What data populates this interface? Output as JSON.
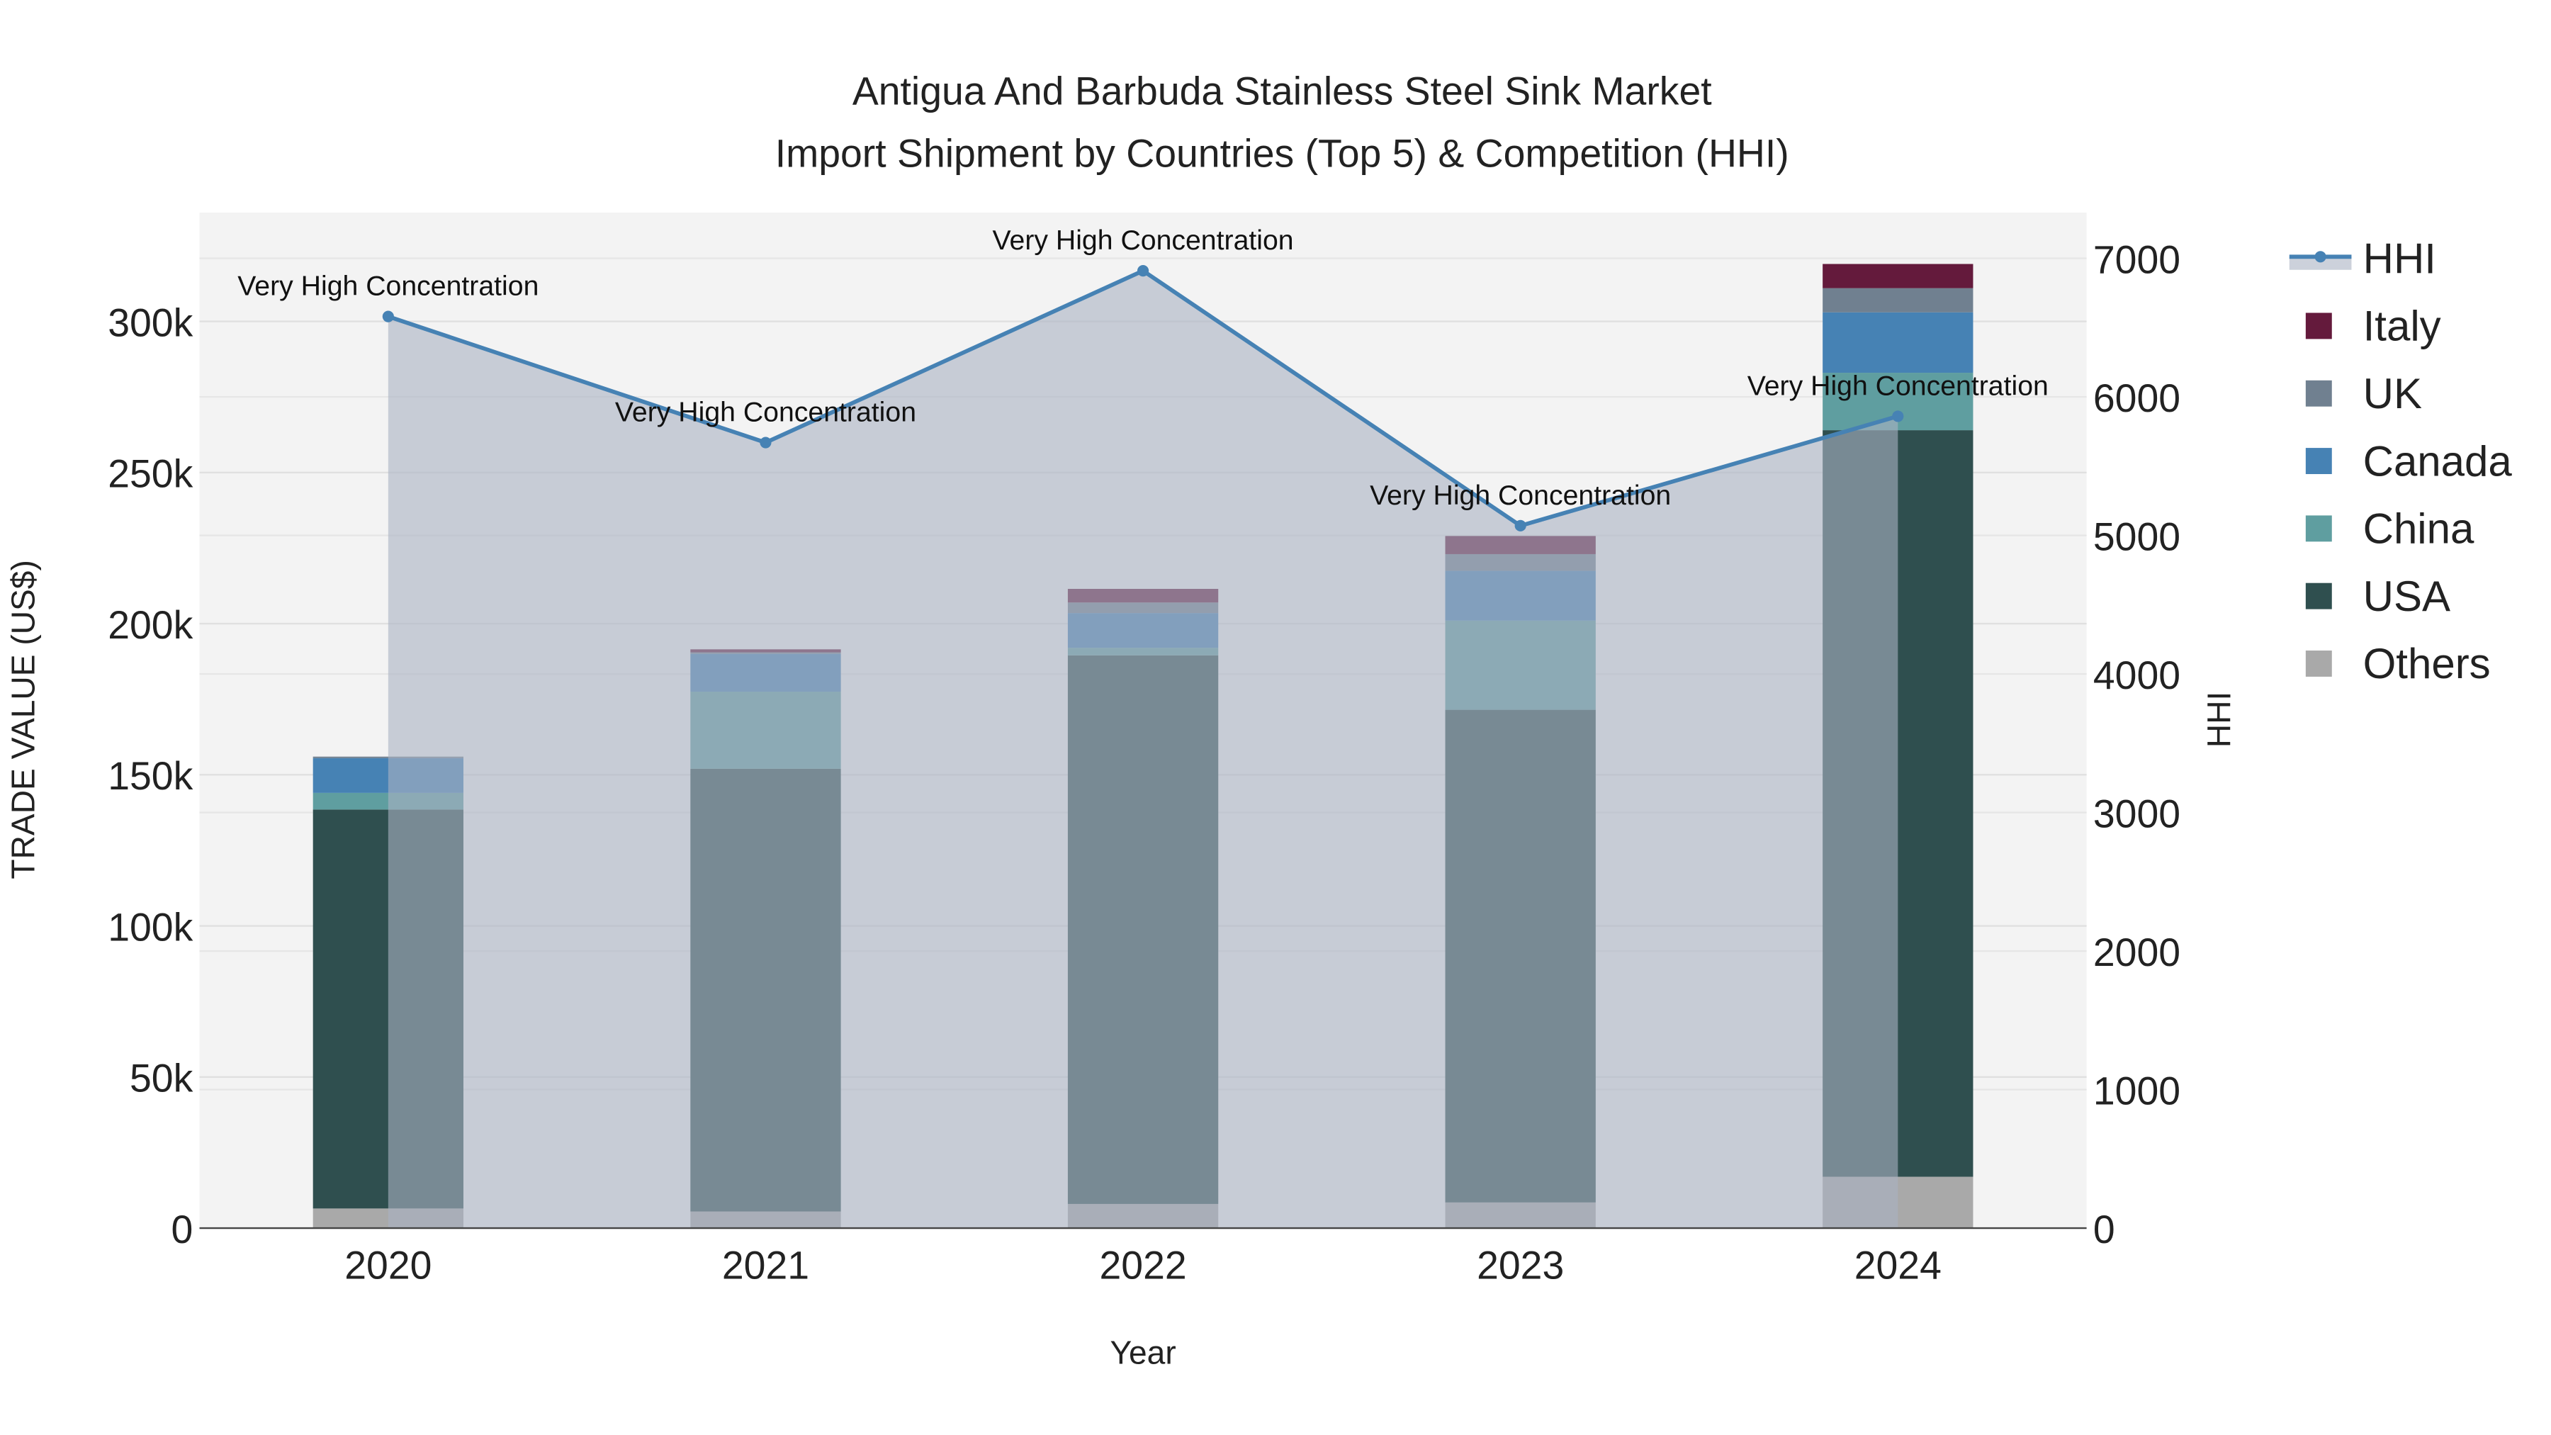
{
  "chart_data": {
    "type": "bar",
    "title_line1": "Antigua And Barbuda Stainless Steel Sink Market",
    "title_line2": "Import Shipment by Countries (Top 5) & Competition (HHI)",
    "xlabel": "Year",
    "ylabel": "TRADE VALUE (US$)",
    "y2label": "HHI",
    "categories": [
      "2020",
      "2021",
      "2022",
      "2023",
      "2024"
    ],
    "ylim": [
      0,
      336000
    ],
    "y2lim": [
      0,
      7330
    ],
    "yticks": [
      0,
      50000,
      100000,
      150000,
      200000,
      250000,
      300000
    ],
    "ytick_labels": [
      "0",
      "50k",
      "100k",
      "150k",
      "200k",
      "250k",
      "300k"
    ],
    "y2ticks": [
      0,
      1000,
      2000,
      3000,
      4000,
      5000,
      6000,
      7000
    ],
    "y2tick_labels": [
      "0",
      "1000",
      "2000",
      "3000",
      "4000",
      "5000",
      "6000",
      "7000"
    ],
    "series": [
      {
        "name": "Others",
        "color": "#a9a9a9",
        "values": [
          6500,
          5500,
          8000,
          8500,
          17000
        ]
      },
      {
        "name": "USA",
        "color": "#2f4f4f",
        "values": [
          132000,
          146500,
          181500,
          163000,
          247000
        ]
      },
      {
        "name": "China",
        "color": "#5f9ea0",
        "values": [
          5500,
          25500,
          2500,
          29500,
          19000
        ]
      },
      {
        "name": "Canada",
        "color": "#4682b4",
        "values": [
          11500,
          12500,
          11500,
          16500,
          20000
        ]
      },
      {
        "name": "UK",
        "color": "#708090",
        "values": [
          500,
          500,
          3500,
          5500,
          8000
        ]
      },
      {
        "name": "Italy",
        "color": "#641a3c",
        "values": [
          0,
          1000,
          4500,
          6000,
          8000
        ]
      }
    ],
    "hhi": {
      "name": "HHI",
      "color": "#4682b4",
      "values": [
        6580,
        5670,
        6910,
        5070,
        5860
      ],
      "annotations": [
        "Very High Concentration",
        "Very High Concentration",
        "Very High Concentration",
        "Very High Concentration",
        "Very High Concentration"
      ]
    },
    "legend": [
      "HHI",
      "Italy",
      "UK",
      "Canada",
      "China",
      "USA",
      "Others"
    ],
    "legend_placement": "right",
    "grid": true
  }
}
